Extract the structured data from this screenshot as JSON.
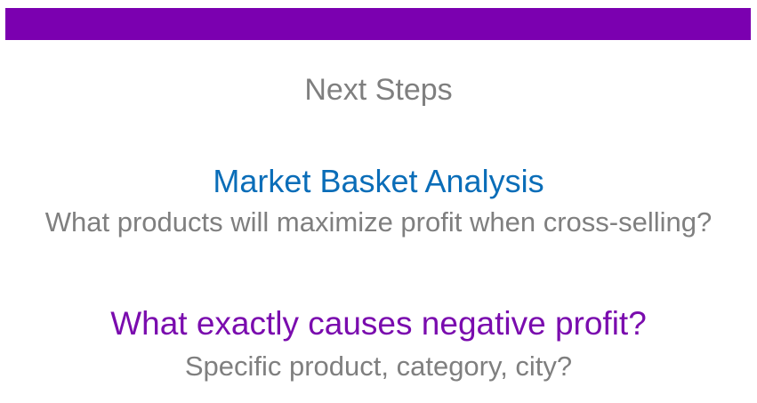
{
  "slide": {
    "accent_bar_color": "#7b00b0",
    "title": "Next Steps",
    "steps": [
      {
        "heading": "Market Basket Analysis",
        "heading_color": "#0a6db8",
        "subtext": "What products will maximize profit when cross-selling?"
      },
      {
        "heading": "What exactly causes negative profit?",
        "heading_color": "#7a0cae",
        "subtext": "Specific product, category, city?"
      }
    ]
  }
}
